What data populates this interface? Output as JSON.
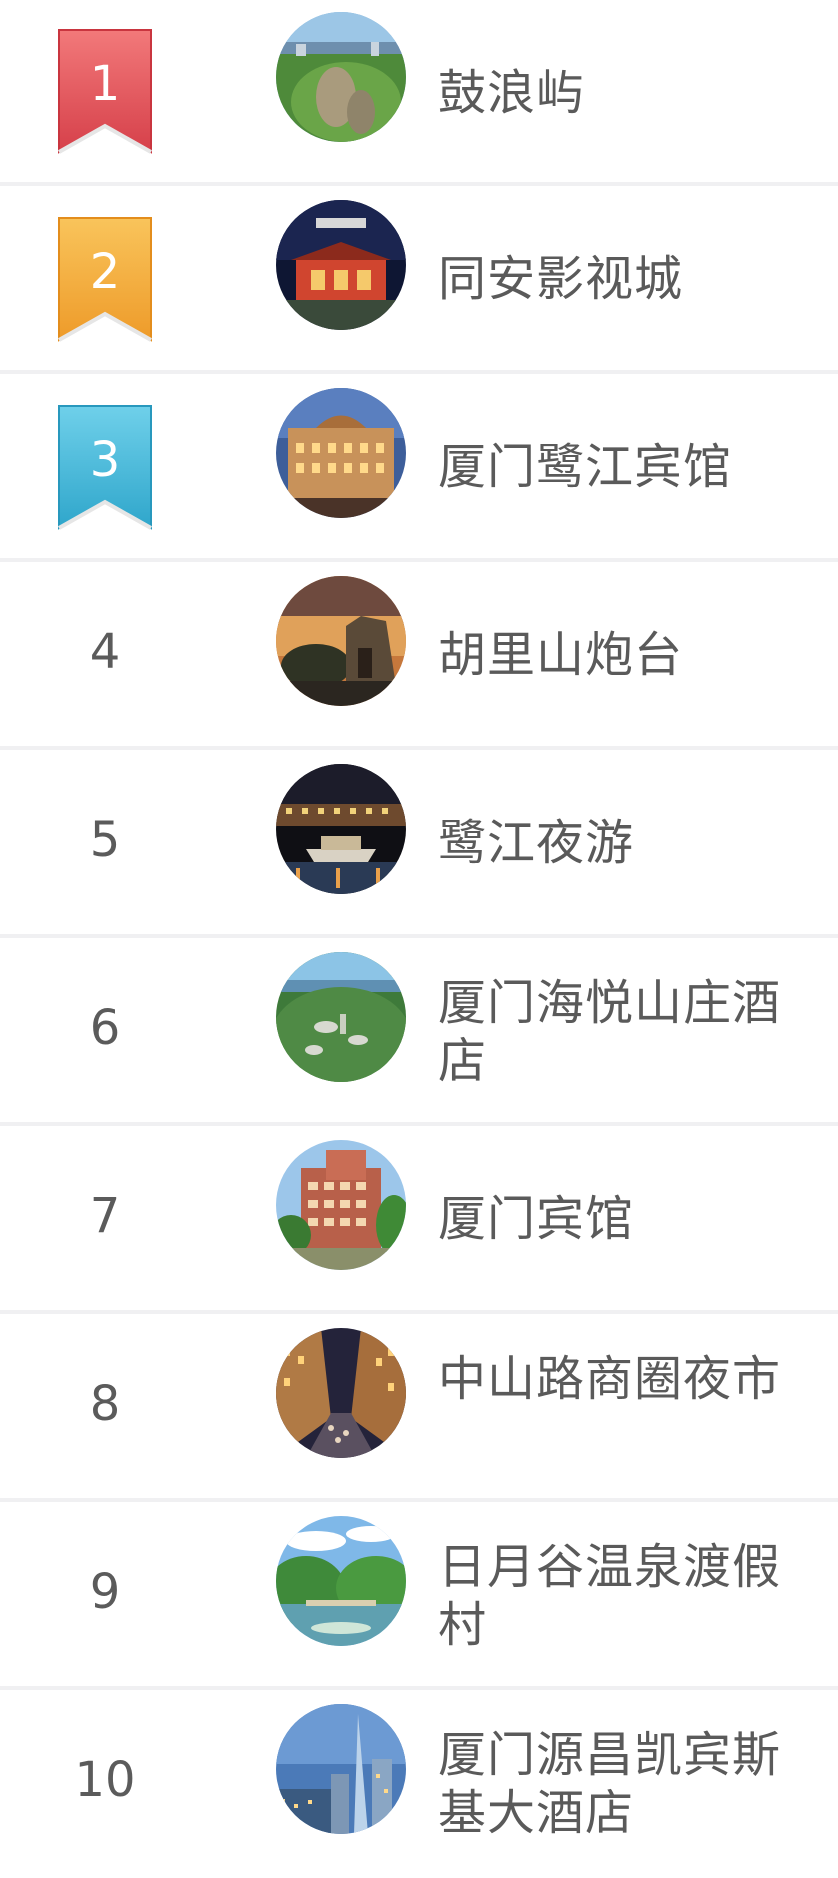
{
  "ranking": {
    "items": [
      {
        "rank": "1",
        "name": "鼓浪屿",
        "ribbon_color": "#e8585a",
        "ribbon_dark": "#c93c44",
        "photo_theme": "island-aerial-photo"
      },
      {
        "rank": "2",
        "name": "同安影视城",
        "ribbon_color": "#f6b13e",
        "ribbon_dark": "#e58f1f",
        "photo_theme": "palace-night-photo"
      },
      {
        "rank": "3",
        "name": "厦门鹭江宾馆",
        "ribbon_color": "#4fc1df",
        "ribbon_dark": "#2aa4c8",
        "photo_theme": "hotel-dusk-photo"
      },
      {
        "rank": "4",
        "name": "胡里山炮台",
        "photo_theme": "fortress-sunset-photo"
      },
      {
        "rank": "5",
        "name": "鹭江夜游",
        "photo_theme": "night-cruise-photo"
      },
      {
        "rank": "6",
        "name": "厦门海悦山庄酒店",
        "photo_theme": "resort-aerial-photo"
      },
      {
        "rank": "7",
        "name": "厦门宾馆",
        "photo_theme": "hotel-day-photo"
      },
      {
        "rank": "8",
        "name": "中山路商圈夜市",
        "photo_theme": "night-street-photo"
      },
      {
        "rank": "9",
        "name": "日月谷温泉渡假村",
        "photo_theme": "hot-spring-photo"
      },
      {
        "rank": "10",
        "name": "厦门源昌凯宾斯基大酒店",
        "photo_theme": "skyline-tower-photo"
      }
    ]
  }
}
